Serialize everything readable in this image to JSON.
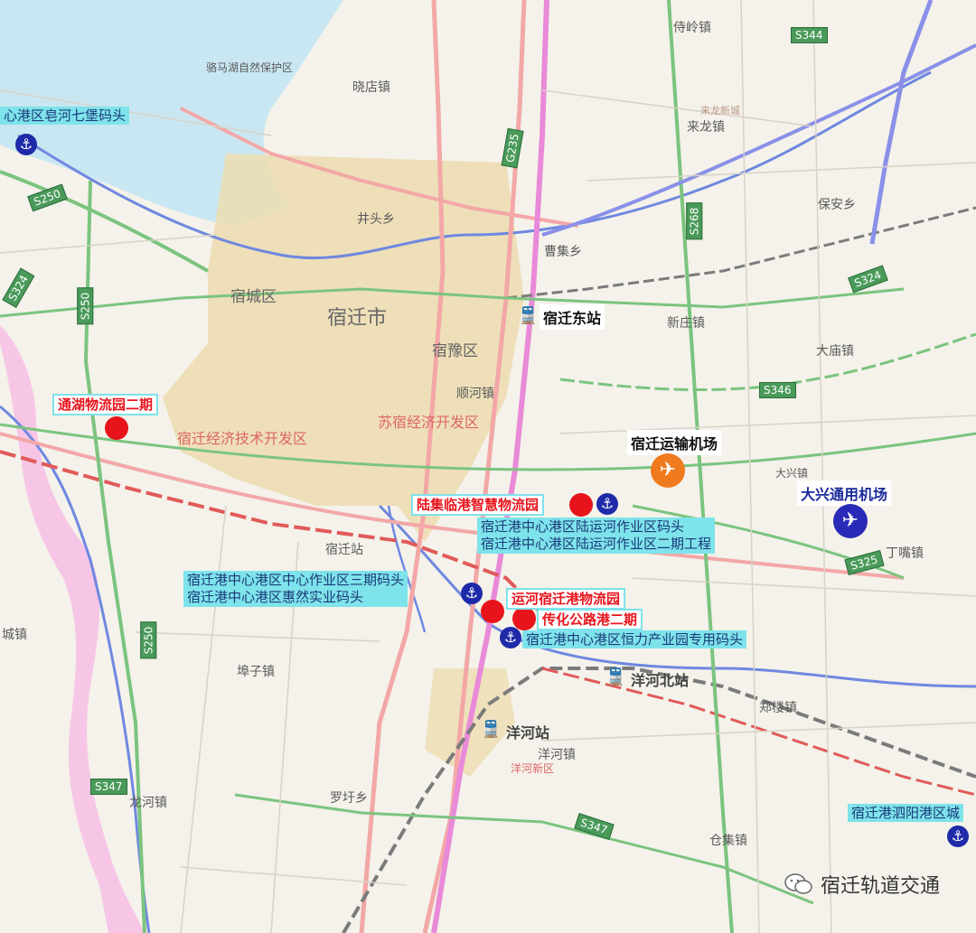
{
  "places": {
    "siyang_lake_reserve": "骆马湖自然保护区",
    "xiaodian": "晓店镇",
    "shilingzhen": "侍岭镇",
    "dongzhen": "来龙镇",
    "dongxin": "来龙新城",
    "jingtou": "井头乡",
    "caoji": "曹集乡",
    "suchengqu": "宿城区",
    "suqianshi": "宿迁市",
    "suyuqu": "宿豫区",
    "shunhe": "顺河镇",
    "xinzhuang": "新庄镇",
    "baoan": "保安乡",
    "daxing": "大兴镇",
    "dingzui": "丁嘴镇",
    "lumiao": "大庙镇",
    "kaifaqu": "宿迁经济技术开发区",
    "kaifaqu2": "苏宿经济开发区",
    "chenggan": "宿迁站",
    "pozi": "埠子镇",
    "luolou": "罗圩乡",
    "longhe": "龙河镇",
    "yanghexin": "洋河新区",
    "yangheqiz": "洋河镇",
    "zhenglou": "郑楼镇",
    "cangji": "仓集镇",
    "chengxiang": "城镇"
  },
  "roads": {
    "s344": "S344",
    "g235": "G235",
    "s250a": "S250",
    "s250b": "S250",
    "s250c": "S250",
    "s268": "S268",
    "s324": "S324",
    "s324b": "S324",
    "s346": "S346",
    "s325": "S325",
    "s347": "S347",
    "s347b": "S347"
  },
  "projects": {
    "tonghu": "通湖物流园二期",
    "luji": "陆集临港智慧物流园",
    "yunhe": "运河宿迁港物流园",
    "chuanhua": "传化公路港二期"
  },
  "ports": {
    "zaohe": "心港区皂河七堡码头",
    "luyunhe_1": "宿迁港中心港区陆运河作业区码头",
    "luyunhe_2": "宿迁港中心港区陆运河作业区二期工程",
    "zhongxin_1": "宿迁港中心港区中心作业区三期码头",
    "zhongxin_2": "宿迁港中心港区惠然实业码头",
    "hengli": "宿迁港中心港区恒力产业园专用码头",
    "siyang": "宿迁港泗阳港区城"
  },
  "stations": {
    "east": "宿迁东站",
    "yanghe": "洋河站",
    "yanghe_north": "洋河北站"
  },
  "airports": {
    "suqian": "宿迁运输机场",
    "daxing": "大兴通用机场"
  },
  "colors": {
    "project_red": "#e8141c",
    "port_blue": "#1e2aa8",
    "label_cyan": "#7ee3ea",
    "airport_orange": "#f07a1e",
    "airport_blue": "#2a2ab8",
    "lake": "#c9e7f2",
    "urban": "#ecdcb0",
    "province_border": "#f4b7e2"
  },
  "watermark": {
    "text": "宿迁轨道交通"
  }
}
